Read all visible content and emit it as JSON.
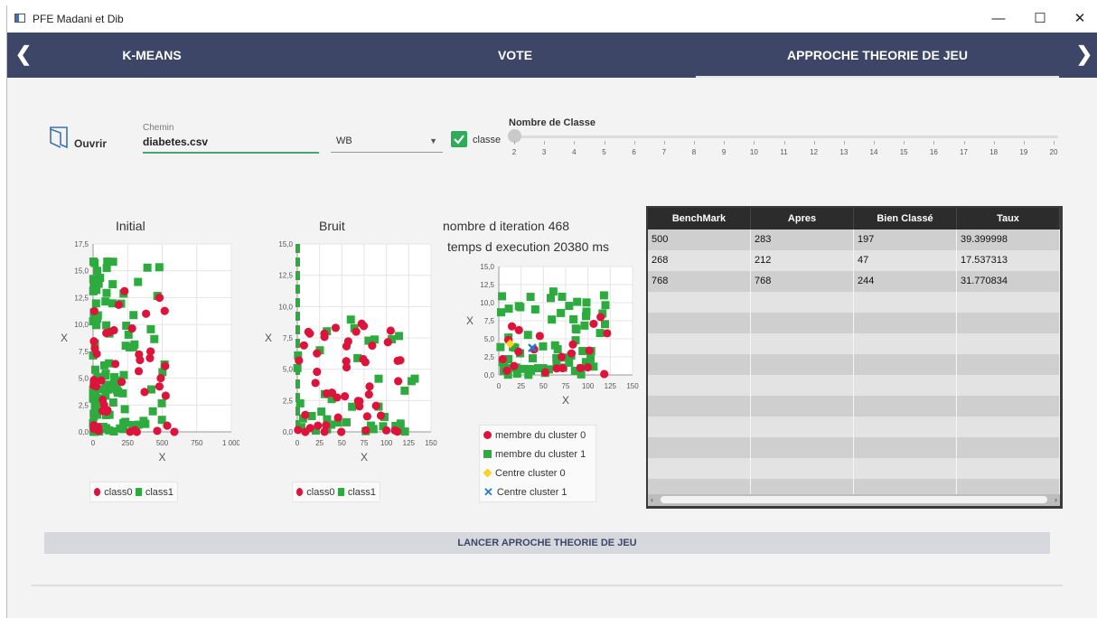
{
  "window": {
    "title": "PFE Madani et Dib",
    "controls": {
      "minimize": "—",
      "maximize": "☐",
      "close": "✕"
    }
  },
  "nav": {
    "prev": "❮",
    "next": "❯",
    "tabs": [
      {
        "label": "K-MEANS",
        "active": false
      },
      {
        "label": "VOTE",
        "active": false
      },
      {
        "label": "APPROCHE THEORIE DE JEU",
        "active": true
      }
    ]
  },
  "toolbar": {
    "open_label": "Ouvrir",
    "path_label": "Chemin",
    "path_value": "diabetes.csv",
    "combo_value": "WB",
    "checkbox_label": "classe",
    "checkbox_checked": true
  },
  "slider": {
    "title": "Nombre de Classe",
    "min": 2,
    "max": 20,
    "value": 2,
    "ticks": [
      "2",
      "3",
      "4",
      "5",
      "6",
      "7",
      "8",
      "9",
      "10",
      "11",
      "12",
      "13",
      "14",
      "15",
      "16",
      "17",
      "18",
      "19",
      "20"
    ]
  },
  "charts": {
    "initial": {
      "title": "Initial",
      "xlabel": "X",
      "ylabel": "X",
      "xticks": [
        "0",
        "250",
        "500",
        "750",
        "1 000"
      ],
      "yticks": [
        "0,0",
        "2,5",
        "5,0",
        "7,5",
        "10,0",
        "12,5",
        "15,0",
        "17,5"
      ],
      "legend": [
        "class0",
        "class1"
      ]
    },
    "bruit": {
      "title": "Bruit",
      "xlabel": "X",
      "ylabel": "X",
      "xticks": [
        "0",
        "25",
        "50",
        "75",
        "100",
        "125",
        "150"
      ],
      "yticks": [
        "0,0",
        "2,5",
        "5,0",
        "7,5",
        "10,0",
        "12,5",
        "15,0"
      ],
      "legend": [
        "class0",
        "class1"
      ]
    },
    "result": {
      "title_line1": "nombre d iteration 468",
      "title_line2": "temps d execution 20380 ms",
      "xlabel": "X",
      "ylabel": "X",
      "xticks": [
        "0",
        "25",
        "50",
        "75",
        "100",
        "125",
        "150"
      ],
      "yticks": [
        "0,0",
        "2,5",
        "5,0",
        "7,5",
        "10,0",
        "12,5",
        "15,0"
      ],
      "legend": [
        "membre du cluster 0",
        "membre du cluster 1",
        "Centre cluster 0",
        "Centre cluster 1"
      ]
    }
  },
  "colors": {
    "class0": "#dc143c",
    "class1": "#2eab3f",
    "center0": "#f7d51d",
    "center1": "#1f7fd1",
    "nav_bg": "#3d4666"
  },
  "table": {
    "headers": [
      "BenchMark",
      "Apres",
      "Bien Classé",
      "Taux"
    ],
    "rows": [
      [
        "500",
        "283",
        "197",
        "39.399998"
      ],
      [
        "268",
        "212",
        "47",
        "17.537313"
      ],
      [
        "768",
        "768",
        "244",
        "31.770834"
      ]
    ],
    "empty_rows": 10,
    "scroll_left": "‹",
    "scroll_right": "›"
  },
  "run_button": "LANCER APROCHE THEORIE DE JEU"
}
